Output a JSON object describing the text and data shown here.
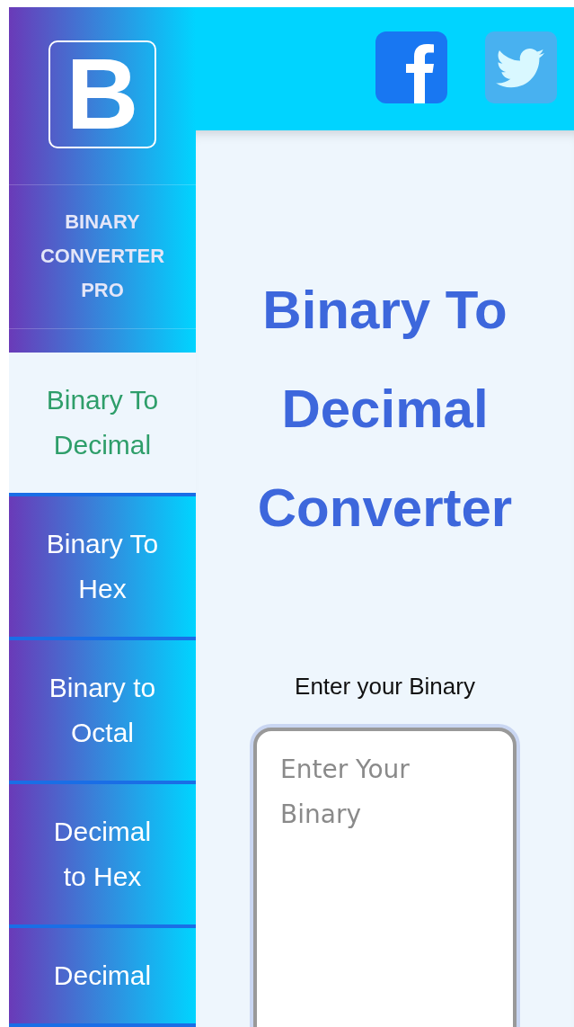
{
  "logo": {
    "letter": "B"
  },
  "brand": "BINARY CONVERTER PRO",
  "nav": [
    {
      "label": "Binary To Decimal",
      "selected": true
    },
    {
      "label": "Binary To Hex",
      "selected": false
    },
    {
      "label": "Binary to Octal",
      "selected": false
    },
    {
      "label": "Decimal to Hex",
      "selected": false
    },
    {
      "label": "Decimal",
      "selected": false
    }
  ],
  "heading": "Binary To Decimal Converter",
  "input_label": "Enter your Binary",
  "textarea": {
    "placeholder": "Enter Your Binary"
  }
}
